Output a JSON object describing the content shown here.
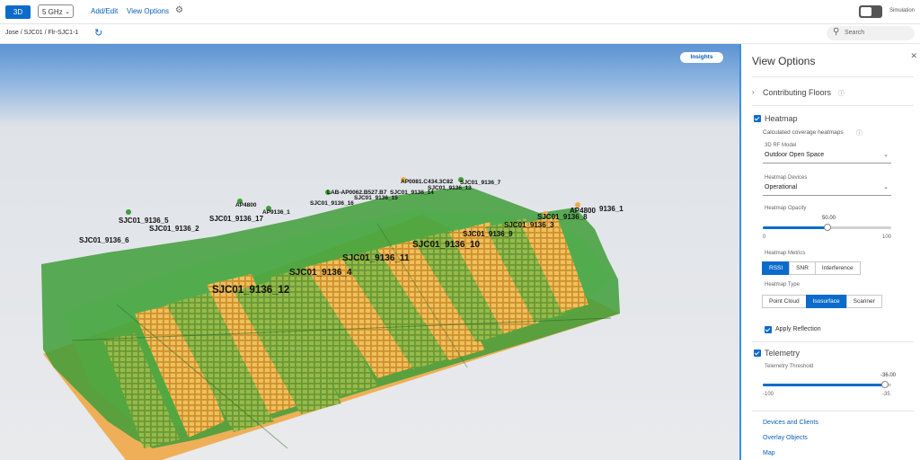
{
  "topbar": {
    "view_3d_label": "3D",
    "band_value": "5 GHz",
    "add_edit_label": "Add/Edit",
    "view_options_label": "View Options",
    "simulation_label": "Simulation"
  },
  "breadcrumb": {
    "path": "Jose / SJC01 / Flr-SJC1-1"
  },
  "search": {
    "placeholder": "Search"
  },
  "viewport": {
    "insights_label": "Insights",
    "ap_labels": [
      "SJC01_9136_5",
      "SJC01_9136_6",
      "SJC01_9136_2",
      "SJC01_9136_17",
      "AP4800",
      "AP9136_1",
      "SJC01_9136_16",
      "LAB-AP0062.B527.B7",
      "SJC01_9136_15",
      "AP0081.C434.3C82",
      "SJC01_9136_14",
      "SJC01_9136_7",
      "SJC01_9136_13",
      "SJC01_9136_8",
      "AP4800",
      "9136_1",
      "SJC01_9136_3",
      "SJC01_9136_9",
      "SJC01_9136_10",
      "SJC01_9136_11",
      "SJC01_9136_4",
      "SJC01_9136_12"
    ]
  },
  "panel": {
    "title": "View Options",
    "contributing_floors": "Contributing Floors",
    "heatmap": {
      "label": "Heatmap",
      "checked": true,
      "subtitle": "Calculated coverage heatmaps",
      "rf_model_label": "3D RF Model",
      "rf_model_value": "Outdoor Open Space",
      "devices_label": "Heatmap Devices",
      "devices_value": "Operational",
      "opacity_label": "Heatmap Opacity",
      "opacity_value": "50.00",
      "opacity_fraction": 0.5,
      "opacity_min": "0",
      "opacity_max": "100",
      "metrics_label": "Heatmap Metrics",
      "metrics": [
        "RSSI",
        "SNR",
        "Interference"
      ],
      "metric_selected": 0,
      "type_label": "Heatmap Type",
      "types": [
        "Point Cloud",
        "Isosurface",
        "Scanner"
      ],
      "type_selected": 1
    },
    "apply_reflection": "Apply Reflection",
    "telemetry": {
      "label": "Telemetry",
      "threshold_label": "Telemetry Threshold",
      "threshold_value": "-36.00",
      "threshold_fraction": 0.95,
      "min": "-100",
      "max": "-35"
    },
    "links": [
      "Devices and Clients",
      "Overlay Objects",
      "Map"
    ]
  },
  "colors": {
    "accent": "#0b6bcb",
    "heatmap_green": "#3f9e3a",
    "heatmap_orange": "#f0a948",
    "sky": "#5b93d3"
  }
}
